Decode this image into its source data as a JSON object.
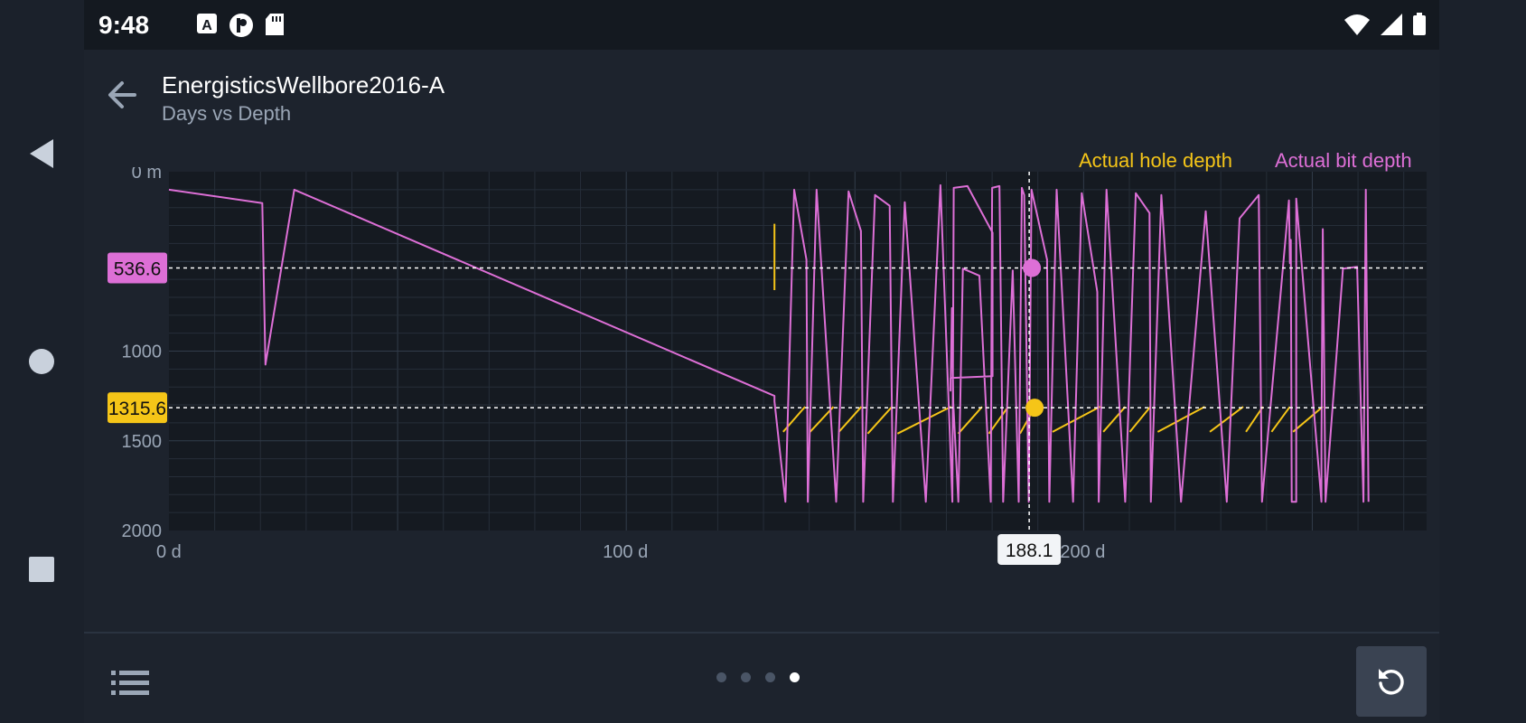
{
  "status": {
    "time": "9:48",
    "icons": [
      "a-icon",
      "p-icon",
      "sd-icon",
      "wifi-icon",
      "signal-icon",
      "battery-icon"
    ]
  },
  "header": {
    "title": "EnergisticsWellbore2016-A",
    "subtitle": "Days vs Depth"
  },
  "legend": {
    "hole": "Actual hole depth",
    "bit": "Actual bit depth"
  },
  "colors": {
    "hole": "#f5c518",
    "bit": "#dd6fd6",
    "bg": "#1d232d",
    "plot_bg": "#151a21"
  },
  "chart_data": {
    "type": "line",
    "xlabel": "",
    "ylabel": "",
    "x_ticks": [
      "0 d",
      "100 d",
      "200 d"
    ],
    "y_ticks": [
      "0 m",
      "1000",
      "1500",
      "2000"
    ],
    "xlim": [
      0,
      275
    ],
    "ylim": [
      2000,
      0
    ],
    "crosshair": {
      "x_label": "188.1",
      "bit_label": "536.6",
      "hole_label": "1315.6"
    },
    "series": [
      {
        "name": "Actual bit depth",
        "points": [
          [
            0,
            100
          ],
          [
            20.4,
            175
          ],
          [
            21.1,
            1075
          ],
          [
            27.4,
            100
          ],
          [
            132.4,
            1250
          ],
          [
            132.4,
            1280
          ],
          [
            134.8,
            1840
          ],
          [
            136.7,
            100
          ],
          [
            139.4,
            490
          ],
          [
            139.7,
            1840
          ],
          [
            141.6,
            100
          ],
          [
            145.9,
            1840
          ],
          [
            148.6,
            110
          ],
          [
            151.3,
            330
          ],
          [
            151.8,
            1840
          ],
          [
            154.4,
            130
          ],
          [
            157.6,
            190
          ],
          [
            158.3,
            1840
          ],
          [
            160.9,
            170
          ],
          [
            165.5,
            1840
          ],
          [
            168.7,
            75
          ],
          [
            171.3,
            1840
          ],
          [
            171.6,
            90
          ],
          [
            174.6,
            80
          ],
          [
            180.1,
            340
          ],
          [
            180.1,
            1140
          ],
          [
            170.9,
            1150
          ],
          [
            170.9,
            1220
          ],
          [
            171.2,
            760
          ],
          [
            171.5,
            1290
          ],
          [
            172.6,
            1840
          ],
          [
            173.6,
            540
          ],
          [
            177.2,
            580
          ],
          [
            179.7,
            1840
          ],
          [
            180.0,
            90
          ],
          [
            181.6,
            80
          ],
          [
            182.4,
            1840
          ],
          [
            184.5,
            550
          ],
          [
            185.8,
            1840
          ],
          [
            186.5,
            90
          ],
          [
            187.0,
            130
          ],
          [
            188.0,
            1840
          ],
          [
            188.6,
            100
          ],
          [
            192.0,
            490
          ],
          [
            192.5,
            1840
          ],
          [
            194.1,
            100
          ],
          [
            197.7,
            1840
          ],
          [
            199.6,
            120
          ],
          [
            203.0,
            670
          ],
          [
            203.3,
            1840
          ],
          [
            205.0,
            100
          ],
          [
            209.1,
            1840
          ],
          [
            211.4,
            120
          ],
          [
            214.4,
            230
          ],
          [
            214.7,
            1840
          ],
          [
            217.0,
            130
          ],
          [
            221.3,
            1840
          ],
          [
            226.7,
            220
          ],
          [
            231.3,
            1840
          ],
          [
            234.1,
            260
          ],
          [
            238.3,
            130
          ],
          [
            239.0,
            1840
          ],
          [
            244.9,
            160
          ],
          [
            245.1,
            510
          ],
          [
            245.3,
            380
          ],
          [
            245.5,
            1840
          ],
          [
            246.5,
            1840
          ],
          [
            246.5,
            150
          ],
          [
            252.0,
            1840
          ],
          [
            252.0,
            1520
          ],
          [
            252.3,
            320
          ],
          [
            252.9,
            1840
          ],
          [
            256.7,
            540
          ],
          [
            259.8,
            530
          ],
          [
            261.2,
            1840
          ],
          [
            261.7,
            100
          ],
          [
            262.3,
            1840
          ]
        ]
      },
      {
        "name": "Actual hole depth",
        "segments": [
          [
            [
              132.4,
              290
            ],
            [
              132.4,
              660
            ]
          ],
          [
            [
              134.3,
              1450
            ],
            [
              139.1,
              1310
            ]
          ],
          [
            [
              140.2,
              1450
            ],
            [
              145.3,
              1310
            ]
          ],
          [
            [
              146.5,
              1450
            ],
            [
              151.4,
              1310
            ]
          ],
          [
            [
              152.8,
              1460
            ],
            [
              158.1,
              1310
            ]
          ],
          [
            [
              159.3,
              1460
            ],
            [
              171.0,
              1310
            ]
          ],
          [
            [
              172.6,
              1460
            ],
            [
              177.8,
              1310
            ]
          ],
          [
            [
              179.3,
              1460
            ],
            [
              183.5,
              1310
            ]
          ],
          [
            [
              186.1,
              1460
            ],
            [
              189.4,
              1310
            ]
          ],
          [
            [
              193.2,
              1450
            ],
            [
              203.6,
              1310
            ]
          ],
          [
            [
              204.3,
              1450
            ],
            [
              209.1,
              1310
            ]
          ],
          [
            [
              210.1,
              1450
            ],
            [
              214.6,
              1310
            ]
          ],
          [
            [
              216.2,
              1450
            ],
            [
              226.5,
              1310
            ]
          ],
          [
            [
              227.6,
              1450
            ],
            [
              234.9,
              1310
            ]
          ],
          [
            [
              235.5,
              1450
            ],
            [
              239.2,
              1310
            ]
          ],
          [
            [
              241.1,
              1450
            ],
            [
              245.1,
              1310
            ]
          ],
          [
            [
              245.8,
              1450
            ],
            [
              252.3,
              1310
            ]
          ]
        ]
      }
    ]
  }
}
